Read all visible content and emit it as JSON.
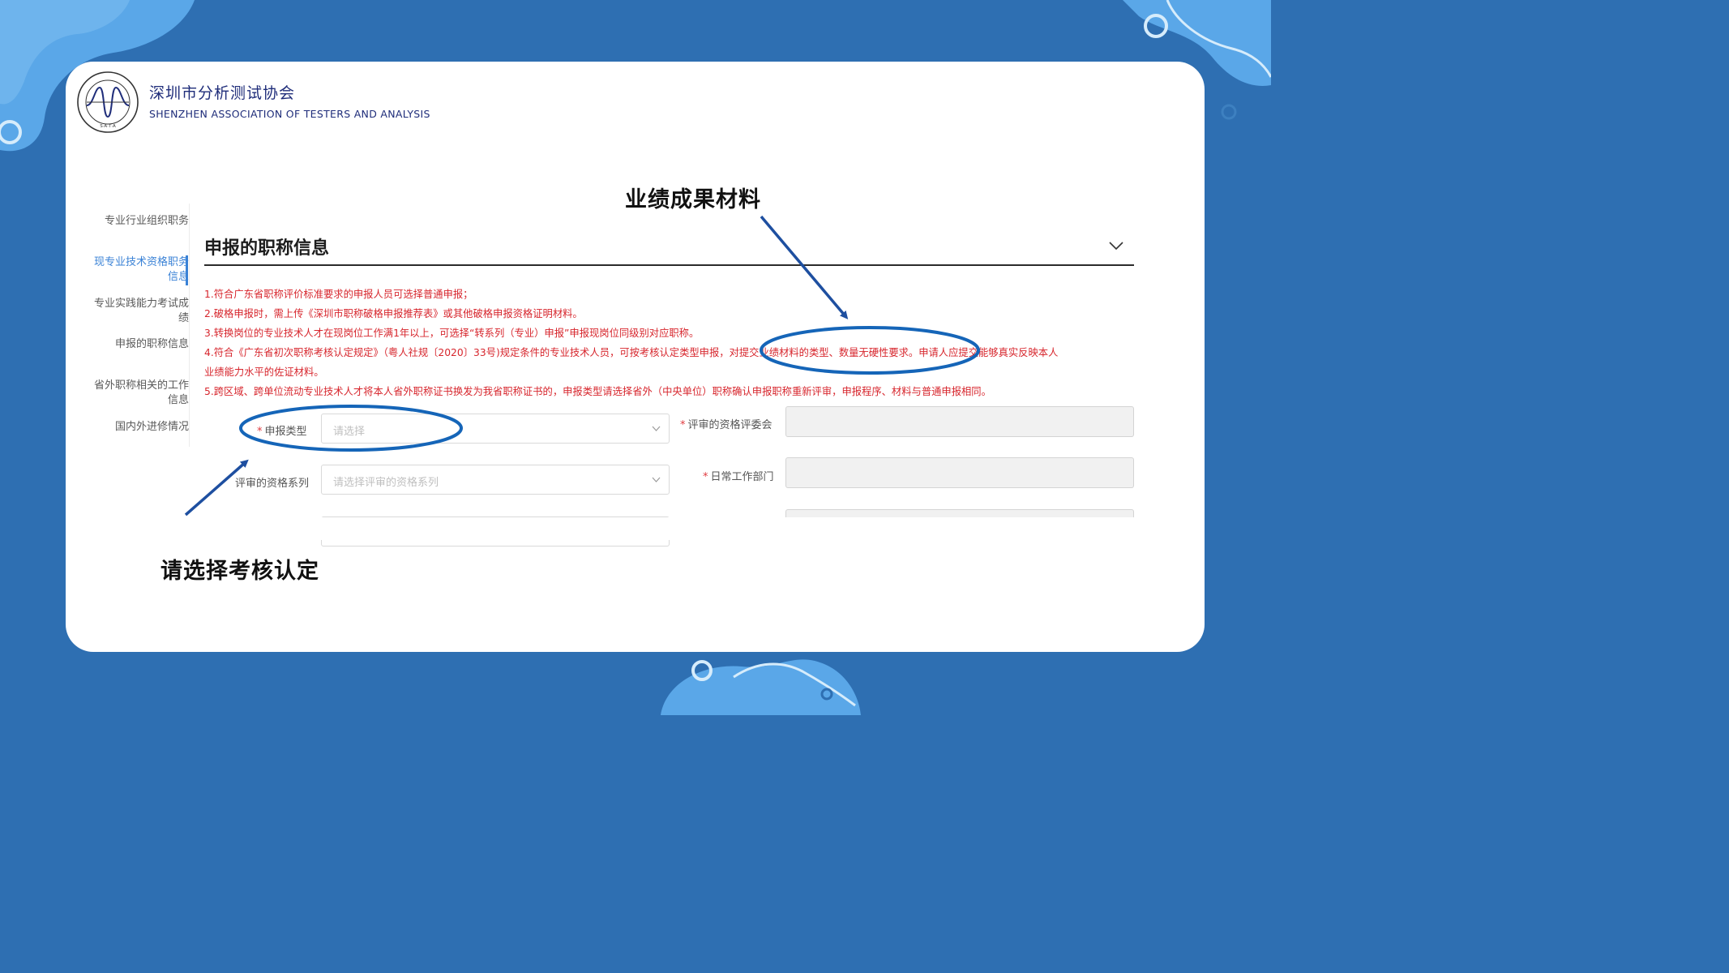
{
  "header": {
    "org_name_cn": "深圳市分析测试协会",
    "org_name_en": "SHENZHEN ASSOCIATION OF TESTERS AND ANALYSIS",
    "seal_text_outer": "SHENZHEN ASSOCIATION OF TESTERS AND ANALYSIS",
    "seal_text_inner": "S·A·T·A"
  },
  "sidebar": {
    "items": [
      {
        "label": "专业行业组织职务"
      },
      {
        "label": "现专业技术资格职务信息",
        "active": true
      },
      {
        "label": "专业实践能力考试成绩"
      },
      {
        "label": "申报的职称信息"
      },
      {
        "label": "省外职称相关的工作信息"
      },
      {
        "label": "国内外进修情况"
      }
    ]
  },
  "section": {
    "title": "申报的职称信息",
    "collapse_icon": "chevron-down-icon",
    "notes": [
      "1.符合广东省职称评价标准要求的申报人员可选择普通申报；",
      "2.破格申报时，需上传《深圳市职称破格申报推荐表》或其他破格申报资格证明材料。",
      "3.转换岗位的专业技术人才在现岗位工作满1年以上，可选择“转系列（专业）申报”申报现岗位同级别对应职称。",
      "4.符合《广东省初次职称考核认定规定》（粤人社规〔2020〕33号)规定条件的专业技术人员，可按考核认定类型申报，对提交业绩材料的类型、数量无硬性要求。申请人应提交能够真实反映本人",
      "业绩能力水平的佐证材料。",
      "5.跨区域、跨单位流动专业技术人才将本人省外职称证书换发为我省职称证书的，申报类型请选择省外（中央单位）职称确认申报职称重新评审，申报程序、材料与普通申报相同。"
    ]
  },
  "form": {
    "apply_type": {
      "label": "申报类型",
      "required": true,
      "placeholder": "请选择"
    },
    "review_committee": {
      "label": "评审的资格评委会",
      "required": true,
      "value": ""
    },
    "qualification_series": {
      "label": "评审的资格系列",
      "required": false,
      "placeholder": "请选择评审的资格系列"
    },
    "daily_work_dept": {
      "label": "日常工作部门",
      "required": true,
      "value": ""
    }
  },
  "annotations": {
    "top_right": "业绩成果材料",
    "bottom_left": "请选择考核认定"
  },
  "colors": {
    "background": "#2e6fb2",
    "accent": "#3a82d6",
    "note_red": "#d7262d",
    "highlight_ring": "#1565b8"
  }
}
